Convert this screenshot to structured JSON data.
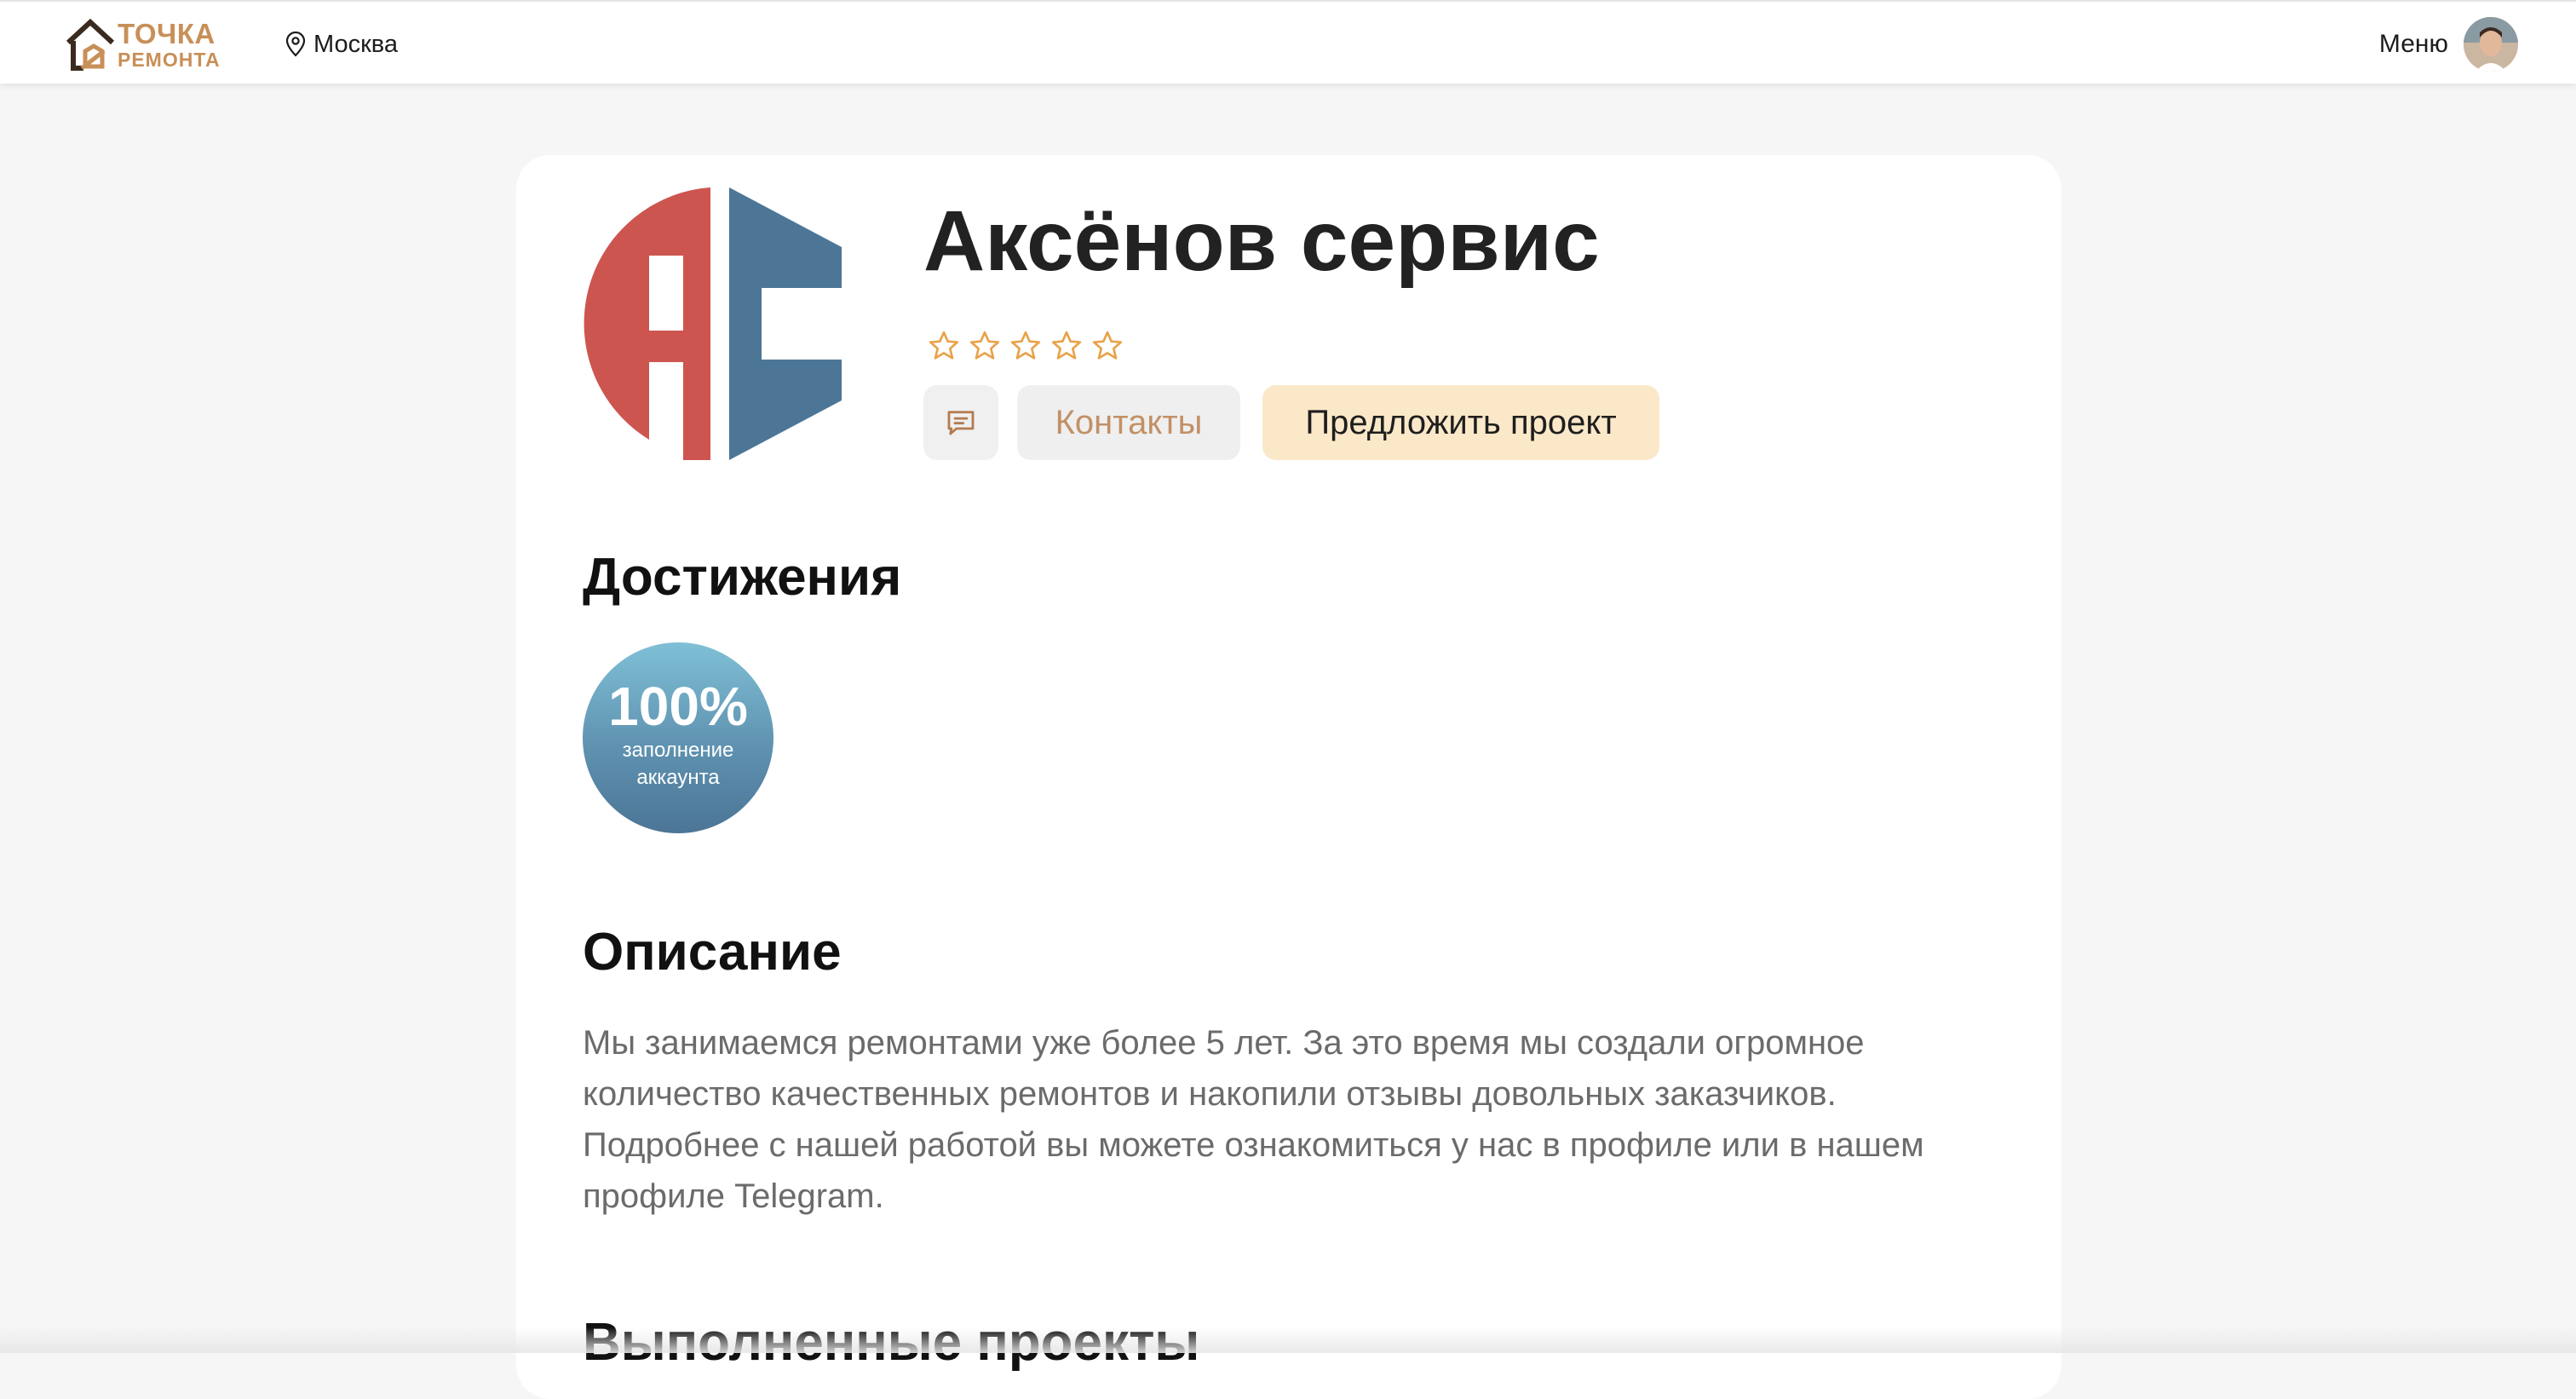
{
  "header": {
    "logo_line1": "ТОЧКА",
    "logo_line2": "РЕМОНТА",
    "city": "Москва",
    "menu_label": "Меню",
    "accent_color": "#c88f57"
  },
  "profile": {
    "company_name": "Аксёнов сервис",
    "logo_letters": "AC",
    "rating_stars_filled": 0,
    "rating_stars_total": 5,
    "contacts_label": "Контакты",
    "propose_label": "Предложить проект"
  },
  "achievements": {
    "title": "Достижения",
    "badge_percent": "100%",
    "badge_line1": "заполнение",
    "badge_line2": "аккаунта"
  },
  "description": {
    "title": "Описание",
    "text": "Мы занимаемся ремонтами уже более 5 лет. За это время мы создали огромное количество качественных ремонтов и накопили отзывы довольных заказчиков. Подробнее с нашей работой вы можете ознакомиться у нас в профиле или в нашем профиле Telegram."
  },
  "projects": {
    "title": "Выполненные проекты"
  }
}
